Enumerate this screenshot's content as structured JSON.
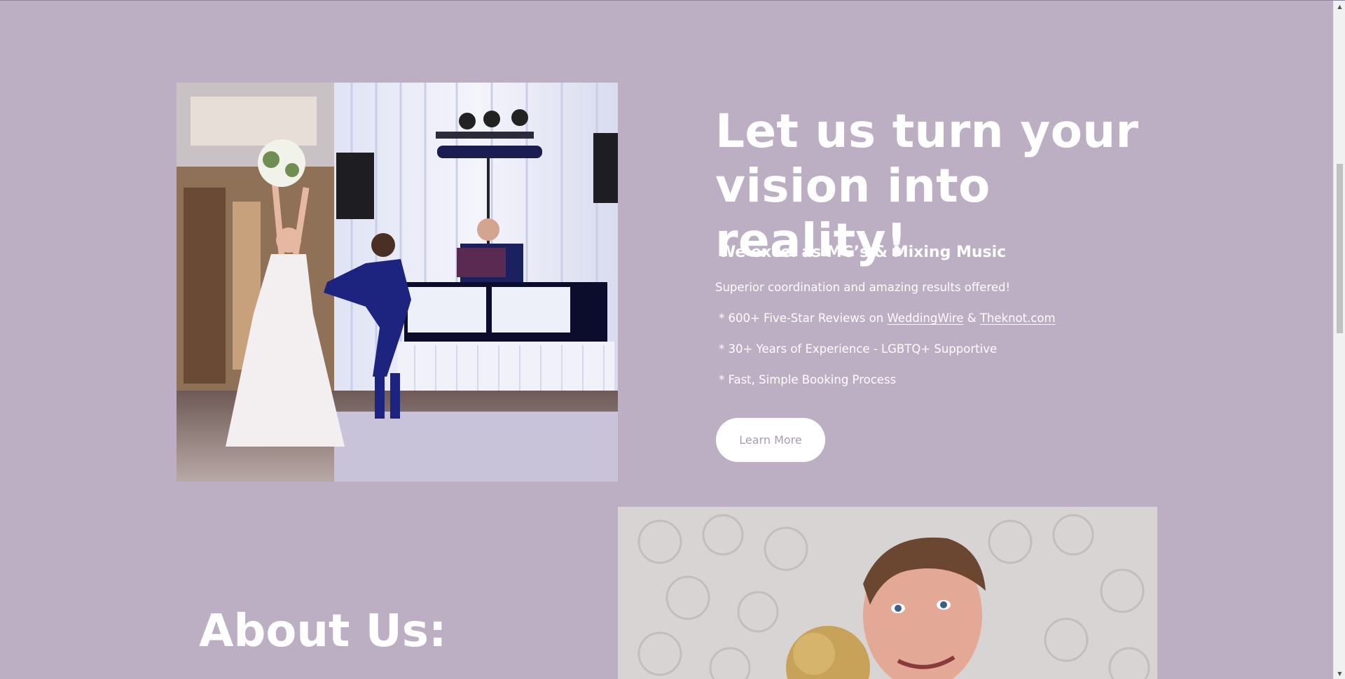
{
  "hero": {
    "title": "Let us turn your vision into reality!",
    "subtitle": "We excel as MC’s & Mixing Music",
    "tagline": "Superior coordination and amazing results offered!",
    "bullets": {
      "reviews_prefix": "* 600+ Five-Star Reviews on ",
      "link_weddingwire": "WeddingWire",
      "amp": " & ",
      "link_theknot": "Theknot.com",
      "experience": "* 30+ Years of Experience - LGBTQ+ Supportive",
      "booking": "* Fast, Simple Booking Process"
    },
    "cta_label": "Learn More",
    "photo_alt": "Bride and groom dancing in front of DJ booth"
  },
  "about": {
    "title": "About Us:",
    "photo_alt": "Couple smiling in front of floral backdrop"
  },
  "colors": {
    "background": "#bcaec3",
    "text": "#ffffff",
    "button_text": "#a99bb1"
  }
}
